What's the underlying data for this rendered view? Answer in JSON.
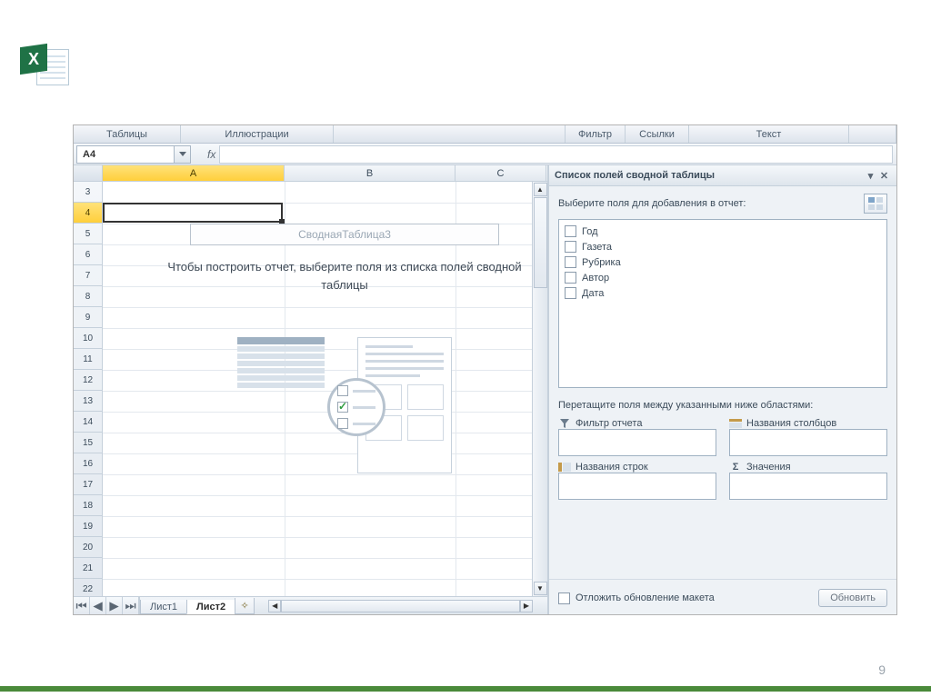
{
  "page_number": "9",
  "ribbon_groups": {
    "tables": "Таблицы",
    "illustrations": "Иллюстрации",
    "filter": "Фильтр",
    "links": "Ссылки",
    "text": "Текст"
  },
  "namebox": {
    "cell_ref": "A4",
    "fx_label": "fx"
  },
  "columns": {
    "A": "A",
    "B": "B",
    "C": "C"
  },
  "rows": [
    "3",
    "4",
    "5",
    "6",
    "7",
    "8",
    "9",
    "10",
    "11",
    "12",
    "13",
    "14",
    "15",
    "16",
    "17",
    "18",
    "19",
    "20",
    "21",
    "22"
  ],
  "active_row": "4",
  "pivot_placeholder": {
    "title": "СводнаяТаблица3",
    "help": "Чтобы построить отчет, выберите поля из списка полей сводной таблицы"
  },
  "sheet_tabs": {
    "sheet1": "Лист1",
    "sheet2": "Лист2"
  },
  "field_pane": {
    "title": "Список полей сводной таблицы",
    "choose_label": "Выберите поля для добавления в отчет:",
    "fields": [
      "Год",
      "Газета",
      "Рубрика",
      "Автор",
      "Дата"
    ],
    "drag_label": "Перетащите поля между указанными ниже областями:",
    "zones": {
      "report_filter": "Фильтр отчета",
      "column_labels": "Названия столбцов",
      "row_labels": "Названия строк",
      "values": "Значения"
    },
    "defer_label": "Отложить обновление макета",
    "update_btn": "Обновить"
  }
}
